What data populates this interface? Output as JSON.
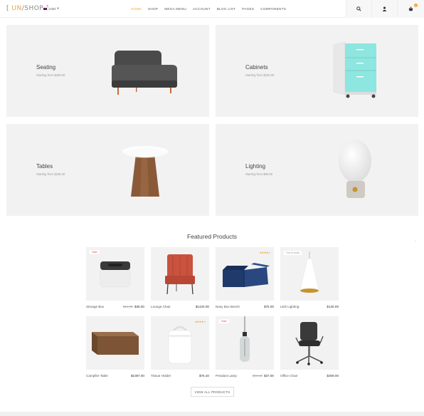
{
  "header": {
    "logo_bracket_open": "[ ",
    "logo_un": "UN",
    "logo_rest": "/SHOP ]",
    "currency": "USD",
    "nav": [
      "HOME",
      "SHOP",
      "MEGA MENU",
      "ACCOUNT",
      "BLOG LIST",
      "PAGES",
      "COMPONENTS"
    ],
    "active_nav": "HOME",
    "cart_count": "0",
    "accent_color": "#f0a13c"
  },
  "categories": [
    {
      "title": "Seating",
      "subtitle": "Starting from $309.00"
    },
    {
      "title": "Cabinets",
      "subtitle": "Starting from $220.00"
    },
    {
      "title": "Tables",
      "subtitle": "Starting from $188.00"
    },
    {
      "title": "Lighting",
      "subtitle": "Starting from $95.99"
    }
  ],
  "featured": {
    "title": "Featured Products",
    "view_all": "VIEW ALL PRODUCTS",
    "products": [
      {
        "name": "Storage Box",
        "old_price": "$14.00",
        "price": "$38.00",
        "badge": "Sale"
      },
      {
        "name": "Lounge Chair",
        "price": "$1420.00"
      },
      {
        "name": "Navy Box Bench",
        "price": "$75.00",
        "rating": 4
      },
      {
        "name": "LED Lighting",
        "price": "$130.00",
        "badge": "Out of stock"
      },
      {
        "name": "Campfire Table",
        "price": "$1087.00"
      },
      {
        "name": "Tissue Holder",
        "price": "$76.40",
        "rating": 4
      },
      {
        "name": "Pendant Lamp",
        "old_price": "$44.10",
        "price": "$37.00",
        "badge": "Sale"
      },
      {
        "name": "Office Chair",
        "price": "$309.00"
      }
    ]
  }
}
